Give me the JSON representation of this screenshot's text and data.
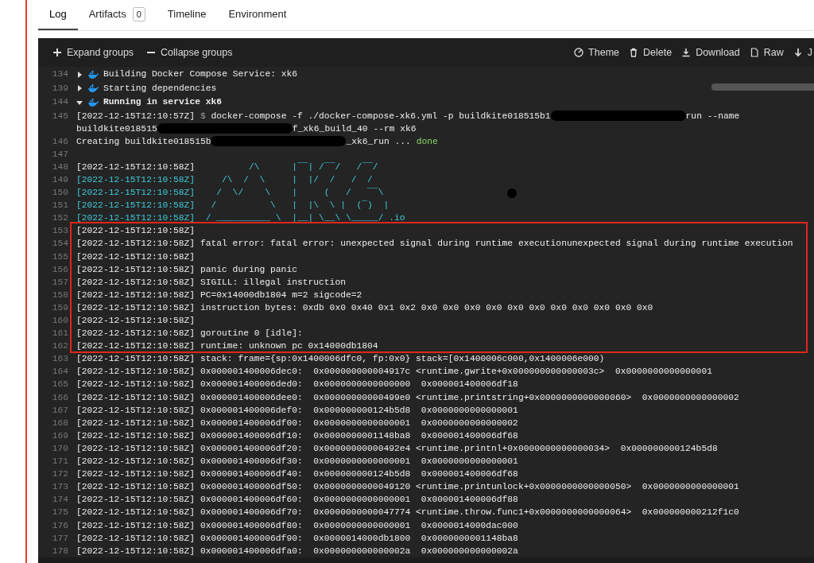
{
  "tabs": [
    {
      "label": "Log",
      "selected": true
    },
    {
      "label": "Artifacts",
      "badge": "0",
      "selected": false
    },
    {
      "label": "Timeline",
      "selected": false
    },
    {
      "label": "Environment",
      "selected": false
    }
  ],
  "toolbar": {
    "left": [
      {
        "label": "Expand groups",
        "kind": "plus"
      },
      {
        "label": "Collapse groups",
        "kind": "minus"
      }
    ],
    "right": [
      {
        "label": "Theme",
        "kind": "theme"
      },
      {
        "label": "Delete",
        "kind": "trash"
      },
      {
        "label": "Download",
        "kind": "download"
      },
      {
        "label": "Raw",
        "kind": "file"
      },
      {
        "label": "J",
        "kind": "arrow"
      }
    ]
  },
  "lines": [
    {
      "number": "134",
      "kind": "group",
      "expanded": false,
      "segments": [
        {
          "text": "Building Docker Compose Service: xk6",
          "kind": "text"
        }
      ]
    },
    {
      "number": "139",
      "kind": "group",
      "expanded": false,
      "segments": [
        {
          "text": "Starting dependencies",
          "kind": "text"
        }
      ]
    },
    {
      "number": "144",
      "kind": "group",
      "expanded": true,
      "segments": [
        {
          "text": "Running in service xk6",
          "kind": "text"
        }
      ]
    },
    {
      "number": "145",
      "kind": "line",
      "segments": [
        {
          "text": "[2022-12-15T12:10:57Z] ",
          "kind": "text"
        },
        {
          "text": "$ ",
          "kind": "prompt"
        },
        {
          "text": "docker-compose -f ./docker-compose-xk6.yml -p buildkite018515b1",
          "kind": "text"
        },
        {
          "kind": "redaction"
        },
        {
          "text": "run --name",
          "kind": "text"
        },
        {
          "kind": "break"
        },
        {
          "text": "buildkite018515",
          "kind": "text"
        },
        {
          "kind": "redaction"
        },
        {
          "text": "f_xk6_build_40 --rm xk6",
          "kind": "text"
        }
      ]
    },
    {
      "number": "146",
      "kind": "line",
      "segments": [
        {
          "text": "Creating buildkite018515b",
          "kind": "text"
        },
        {
          "kind": "redaction"
        },
        {
          "text": "_xk6_run ... ",
          "kind": "text"
        },
        {
          "text": "done",
          "kind": "status"
        }
      ]
    },
    {
      "number": "147",
      "kind": "line"
    },
    {
      "number": "148",
      "kind": "line",
      "segments": [
        {
          "text": "[2022-12-15T12:10:58Z] ",
          "kind": "text"
        },
        {
          "text": "         /\\      |‾‾| /‾‾/   /‾‾/",
          "kind": "ascii"
        }
      ]
    },
    {
      "number": "149",
      "kind": "line",
      "segments": [
        {
          "text": "[2022-12-15T12:10:58Z]     /\\  /  \\     |  |/  /   /  /",
          "kind": "ascii"
        }
      ]
    },
    {
      "number": "150",
      "kind": "line",
      "segments": [
        {
          "text": "[2022-12-15T12:10:58Z]    /  \\/    \\    |     (   /   ‾‾\\",
          "kind": "ascii"
        }
      ]
    },
    {
      "number": "151",
      "kind": "line",
      "segments": [
        {
          "text": "[2022-12-15T12:10:58Z]   /          \\   |  |\\  \\ |  (‾)  |",
          "kind": "ascii"
        }
      ]
    },
    {
      "number": "152",
      "kind": "line",
      "segments": [
        {
          "text": "[2022-12-15T12:10:58Z]  / __________ \\  |__| \\__\\ \\_____/ .io",
          "kind": "ascii"
        }
      ]
    },
    {
      "number": "153",
      "kind": "line",
      "segments": [
        {
          "text": "[2022-12-15T12:10:58Z]",
          "kind": "text"
        }
      ]
    },
    {
      "number": "154",
      "kind": "line",
      "segments": [
        {
          "text": "[2022-12-15T12:10:58Z] fatal error: fatal error: unexpected signal during runtime executionunexpected signal during runtime execution",
          "kind": "text"
        }
      ]
    },
    {
      "number": "155",
      "kind": "line",
      "segments": [
        {
          "text": "[2022-12-15T12:10:58Z]",
          "kind": "text"
        }
      ]
    },
    {
      "number": "156",
      "kind": "line",
      "segments": [
        {
          "text": "[2022-12-15T12:10:58Z] panic during panic",
          "kind": "text"
        }
      ]
    },
    {
      "number": "157",
      "kind": "line",
      "segments": [
        {
          "text": "[2022-12-15T12:10:58Z] SIGILL: illegal instruction",
          "kind": "text"
        }
      ]
    },
    {
      "number": "158",
      "kind": "line",
      "segments": [
        {
          "text": "[2022-12-15T12:10:58Z] PC=0x14000db1804 m=2 sigcode=2",
          "kind": "text"
        }
      ]
    },
    {
      "number": "159",
      "kind": "line",
      "segments": [
        {
          "text": "[2022-12-15T12:10:58Z] instruction bytes: 0xdb 0x0 0x40 0x1 0x2 0x0 0x0 0x0 0x0 0x0 0x0 0x0 0x0 0x0 0x0 0x0",
          "kind": "text"
        }
      ]
    },
    {
      "number": "160",
      "kind": "line",
      "segments": [
        {
          "text": "[2022-12-15T12:10:58Z]",
          "kind": "text"
        }
      ]
    },
    {
      "number": "161",
      "kind": "line",
      "segments": [
        {
          "text": "[2022-12-15T12:10:58Z] goroutine 0 [idle]:",
          "kind": "text"
        }
      ]
    },
    {
      "number": "162",
      "kind": "line",
      "segments": [
        {
          "text": "[2022-12-15T12:10:58Z] runtime: unknown pc 0x14000db1804",
          "kind": "text"
        }
      ]
    },
    {
      "number": "163",
      "kind": "line",
      "segments": [
        {
          "text": "[2022-12-15T12:10:58Z] stack: frame={sp:0x1400006dfc0, fp:0x0} stack=[0x1400006c000,0x1400006e000)",
          "kind": "text"
        }
      ]
    },
    {
      "number": "164",
      "kind": "line",
      "segments": [
        {
          "text": "[2022-12-15T12:10:58Z] 0x000001400006dec0:  0x000000000004917c <runtime.gwrite+0x000000000000003c>  0x0000000000000001",
          "kind": "text"
        }
      ]
    },
    {
      "number": "165",
      "kind": "line",
      "segments": [
        {
          "text": "[2022-12-15T12:10:58Z] 0x000001400006ded0:  0x0000000000000000  0x000001400006df18",
          "kind": "text"
        }
      ]
    },
    {
      "number": "166",
      "kind": "line",
      "segments": [
        {
          "text": "[2022-12-15T12:10:58Z] 0x000001400006dee0:  0x00000000000499e0 <runtime.printstring+0x0000000000000060>  0x0000000000000002",
          "kind": "text"
        }
      ]
    },
    {
      "number": "167",
      "kind": "line",
      "segments": [
        {
          "text": "[2022-12-15T12:10:58Z] 0x000001400006def0:  0x000000000124b5d8  0x0000000000000001",
          "kind": "text"
        }
      ]
    },
    {
      "number": "168",
      "kind": "line",
      "segments": [
        {
          "text": "[2022-12-15T12:10:58Z] 0x000001400006df00:  0x0000000000000001  0x0000000000000002",
          "kind": "text"
        }
      ]
    },
    {
      "number": "169",
      "kind": "line",
      "segments": [
        {
          "text": "[2022-12-15T12:10:58Z] 0x000001400006df10:  0x0000000001148ba8  0x000001400006df68",
          "kind": "text"
        }
      ]
    },
    {
      "number": "170",
      "kind": "line",
      "segments": [
        {
          "text": "[2022-12-15T12:10:58Z] 0x000001400006df20:  0x00000000000492e4 <runtime.printnl+0x0000000000000034>  0x000000000124b5d8",
          "kind": "text"
        }
      ]
    },
    {
      "number": "171",
      "kind": "line",
      "segments": [
        {
          "text": "[2022-12-15T12:10:58Z] 0x000001400006df30:  0x0000000000000001  0x0000000000000001",
          "kind": "text"
        }
      ]
    },
    {
      "number": "172",
      "kind": "line",
      "segments": [
        {
          "text": "[2022-12-15T12:10:58Z] 0x000001400006df40:  0x000000000124b5d8  0x000001400006df68",
          "kind": "text"
        }
      ]
    },
    {
      "number": "173",
      "kind": "line",
      "segments": [
        {
          "text": "[2022-12-15T12:10:58Z] 0x000001400006df50:  0x0000000000049120 <runtime.printunlock+0x0000000000000050>  0x0000000000000001",
          "kind": "text"
        }
      ]
    },
    {
      "number": "174",
      "kind": "line",
      "segments": [
        {
          "text": "[2022-12-15T12:10:58Z] 0x000001400006df60:  0x0000000000000001  0x000001400006df88",
          "kind": "text"
        }
      ]
    },
    {
      "number": "175",
      "kind": "line",
      "segments": [
        {
          "text": "[2022-12-15T12:10:58Z] 0x000001400006df70:  0x0000000000047774 <runtime.throw.func1+0x0000000000000064>  0x000000000212f1c0",
          "kind": "text"
        }
      ]
    },
    {
      "number": "176",
      "kind": "line",
      "segments": [
        {
          "text": "[2022-12-15T12:10:58Z] 0x000001400006df80:  0x0000000000000001  0x0000014000dac000",
          "kind": "text"
        }
      ]
    },
    {
      "number": "177",
      "kind": "line",
      "segments": [
        {
          "text": "[2022-12-15T12:10:58Z] 0x000001400006df90:  0x0000014000db1800  0x0000000001148ba8",
          "kind": "text"
        }
      ]
    },
    {
      "number": "178",
      "kind": "line",
      "segments": [
        {
          "text": "[2022-12-15T12:10:58Z] 0x000001400006dfa0:  0x000000000000002a  0x000000000000002a",
          "kind": "text"
        }
      ]
    }
  ]
}
